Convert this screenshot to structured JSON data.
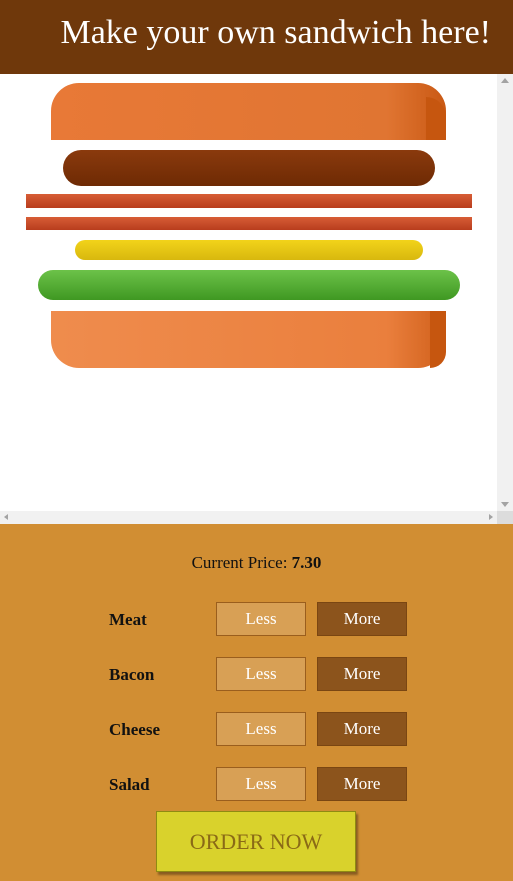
{
  "header": {
    "title": "Make your own sandwich here!"
  },
  "price": {
    "label": "Current Price:",
    "value": "7.30"
  },
  "ingredients": [
    {
      "name": "Meat",
      "less": "Less",
      "more": "More"
    },
    {
      "name": "Bacon",
      "less": "Less",
      "more": "More"
    },
    {
      "name": "Cheese",
      "less": "Less",
      "more": "More"
    },
    {
      "name": "Salad",
      "less": "Less",
      "more": "More"
    }
  ],
  "order": {
    "label": "ORDER NOW"
  },
  "colors": {
    "header_bg": "#6f380b",
    "panel_bg": "#d18e33",
    "less_button": "#d8a055",
    "more_button": "#8c541c",
    "order_button": "#d9d22c"
  }
}
